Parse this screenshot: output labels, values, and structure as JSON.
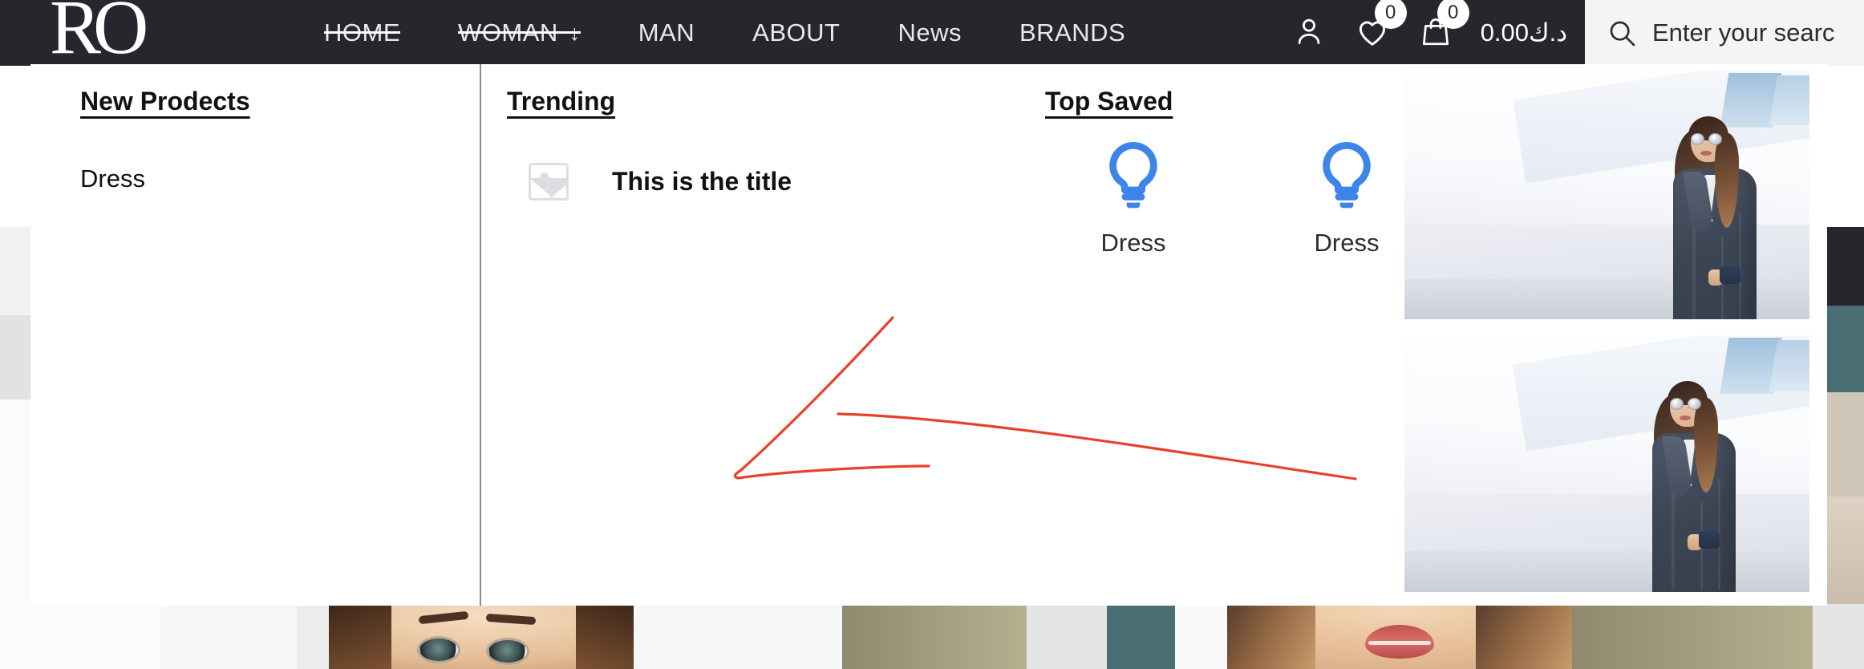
{
  "header": {
    "logo_text": "RO",
    "logo_name": "brand-logo",
    "nav": [
      {
        "label": "HOME",
        "active": true,
        "has_arrow": false
      },
      {
        "label": "WOMAN",
        "active": true,
        "has_arrow": true,
        "arrow_glyph": "↓"
      },
      {
        "label": "MAN",
        "active": false,
        "has_arrow": false
      },
      {
        "label": "ABOUT",
        "active": false,
        "has_arrow": false
      },
      {
        "label": "News",
        "active": false,
        "has_arrow": false
      },
      {
        "label": "BRANDS",
        "active": false,
        "has_arrow": false
      }
    ],
    "account_icon": "user-icon",
    "wishlist_icon": "heart-icon",
    "wishlist_count": "0",
    "cart_icon": "bag-icon",
    "cart_count": "0",
    "cart_total": "0.00د.ك",
    "search": {
      "icon": "search-icon",
      "placeholder": "Enter your searc"
    }
  },
  "mega_menu": {
    "new_products": {
      "heading": "New Prodects",
      "items": [
        {
          "label": "Dress"
        }
      ]
    },
    "trending": {
      "heading": "Trending",
      "items": [
        {
          "title": "This is the title",
          "thumb_icon": "image-placeholder-icon"
        }
      ]
    },
    "top_saved": {
      "heading": "Top Saved",
      "items": [
        {
          "label": "Dress",
          "icon": "lightbulb-icon",
          "icon_color": "#3d85e8"
        },
        {
          "label": "Dress",
          "icon": "lightbulb-icon",
          "icon_color": "#3d85e8"
        }
      ]
    },
    "media": [
      {
        "name": "fashion-photo-1",
        "alt": "Woman in denim coat with sunglasses"
      },
      {
        "name": "fashion-photo-2",
        "alt": "Woman in denim coat with sunglasses"
      }
    ]
  },
  "annotation": {
    "name": "red-arrow-annotation",
    "color": "#e8402a",
    "shape": "left-pointing-arrow"
  },
  "colors": {
    "header_bg": "#25272c",
    "accent_blue": "#3d85e8",
    "annotation_red": "#e8402a",
    "search_bg": "#f4f4f5",
    "teal_block": "#4b6e75"
  }
}
